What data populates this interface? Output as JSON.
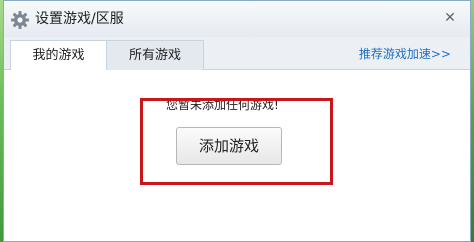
{
  "window": {
    "title": "设置游戏/区服",
    "close_glyph": "✕",
    "icon": "gear-icon"
  },
  "tabs": [
    {
      "label": "我的游戏",
      "active": true
    },
    {
      "label": "所有游戏",
      "active": false
    }
  ],
  "recommend_link": "推荐游戏加速>>",
  "empty_state": {
    "message": "您暂未添加任何游戏!",
    "add_button_label": "添加游戏"
  },
  "colors": {
    "highlight": "#c8161d",
    "link": "#1d6fc2"
  }
}
